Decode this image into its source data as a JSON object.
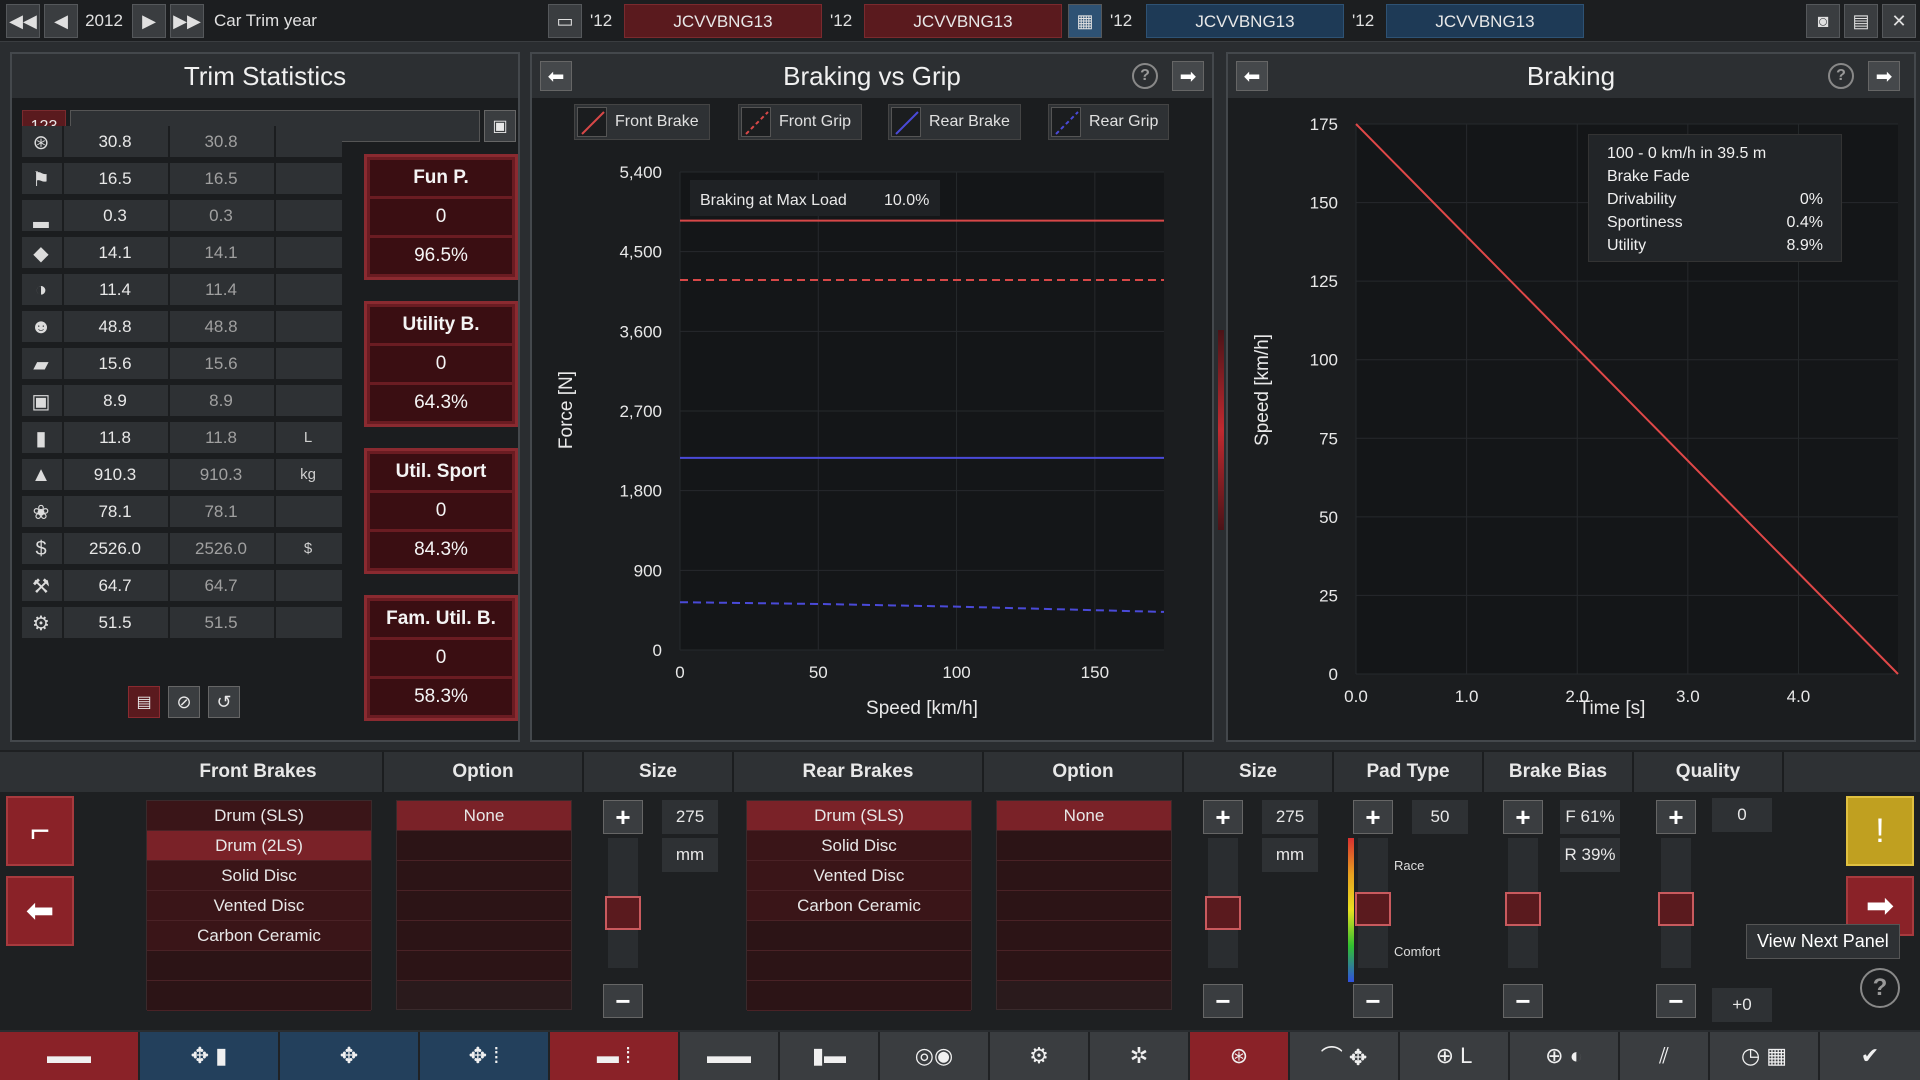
{
  "topbar": {
    "year": "2012",
    "trim_label": "Car Trim year",
    "slots": [
      {
        "year": "'12",
        "name": "JCVVBNG13"
      },
      {
        "year": "'12",
        "name": "JCVVBNG13"
      },
      {
        "year": "'12",
        "name": "JCVVBNG13"
      },
      {
        "year": "'12",
        "name": "JCVVBNG13"
      }
    ]
  },
  "trim": {
    "title": "Trim Statistics",
    "search_label": "123",
    "rows": [
      {
        "icon": "steering-wheel-icon",
        "v1": "30.8",
        "v2": "30.8",
        "unit": ""
      },
      {
        "icon": "race-flag-icon",
        "v1": "16.5",
        "v2": "16.5",
        "unit": ""
      },
      {
        "icon": "seat-icon",
        "v1": "0.3",
        "v2": "0.3",
        "unit": ""
      },
      {
        "icon": "diamond-icon",
        "v1": "14.1",
        "v2": "14.1",
        "unit": ""
      },
      {
        "icon": "safety-icon",
        "v1": "11.4",
        "v2": "11.4",
        "unit": ""
      },
      {
        "icon": "passengers-icon",
        "v1": "48.8",
        "v2": "48.8",
        "unit": ""
      },
      {
        "icon": "cargo-car-icon",
        "v1": "15.6",
        "v2": "15.6",
        "unit": ""
      },
      {
        "icon": "offroad-car-icon",
        "v1": "8.9",
        "v2": "8.9",
        "unit": ""
      },
      {
        "icon": "fuel-can-icon",
        "v1": "11.8",
        "v2": "11.8",
        "unit": "L"
      },
      {
        "icon": "weight-icon",
        "v1": "910.3",
        "v2": "910.3",
        "unit": "kg"
      },
      {
        "icon": "environment-icon",
        "v1": "78.1",
        "v2": "78.1",
        "unit": ""
      },
      {
        "icon": "money-bag-icon",
        "v1": "2526.0",
        "v2": "2526.0",
        "unit": "$"
      },
      {
        "icon": "service-icon",
        "v1": "64.7",
        "v2": "64.7",
        "unit": ""
      },
      {
        "icon": "gear-wrench-icon",
        "v1": "51.5",
        "v2": "51.5",
        "unit": ""
      }
    ],
    "scores": [
      {
        "title": "Fun P.",
        "num": "0",
        "pct": "96.5%"
      },
      {
        "title": "Utility B.",
        "num": "0",
        "pct": "64.3%"
      },
      {
        "title": "Util. Sport",
        "num": "0",
        "pct": "84.3%"
      },
      {
        "title": "Fam. Util. B.",
        "num": "0",
        "pct": "58.3%"
      }
    ]
  },
  "grip": {
    "title": "Braking vs Grip",
    "legend": [
      "Front Brake",
      "Front Grip",
      "Rear Brake",
      "Rear Grip"
    ],
    "annotation_label": "Braking at Max Load",
    "annotation_value": "10.0%"
  },
  "braking": {
    "title": "Braking",
    "info": {
      "line1": "100 - 0 km/h in 39.5 m",
      "line2": "Brake Fade",
      "rows": [
        {
          "k": "Drivability",
          "v": "0%"
        },
        {
          "k": "Sportiness",
          "v": "0.4%"
        },
        {
          "k": "Utility",
          "v": "8.9%"
        }
      ]
    }
  },
  "chart_data": [
    {
      "type": "line",
      "title": "Braking vs Grip",
      "xlabel": "Speed [km/h]",
      "ylabel": "Force [N]",
      "xlim": [
        0,
        175
      ],
      "ylim": [
        0,
        5400
      ],
      "xticks": [
        "0",
        "50",
        "100",
        "150"
      ],
      "yticks": [
        "0",
        "900",
        "1,800",
        "2,700",
        "3,600",
        "4,500",
        "5,400"
      ],
      "series": [
        {
          "name": "Front Brake",
          "color": "#d84848",
          "dash": false,
          "x": [
            0,
            175
          ],
          "y": [
            4850,
            4850
          ]
        },
        {
          "name": "Front Grip",
          "color": "#d84848",
          "dash": true,
          "x": [
            0,
            175
          ],
          "y": [
            4180,
            4180
          ]
        },
        {
          "name": "Rear Brake",
          "color": "#4a4ad8",
          "dash": false,
          "x": [
            0,
            175
          ],
          "y": [
            2170,
            2170
          ]
        },
        {
          "name": "Rear Grip",
          "color": "#4a4ad8",
          "dash": true,
          "x": [
            0,
            50,
            100,
            150,
            175
          ],
          "y": [
            540,
            520,
            490,
            450,
            430
          ]
        }
      ]
    },
    {
      "type": "line",
      "title": "Braking",
      "xlabel": "Time [s]",
      "ylabel": "Speed [km/h]",
      "xlim": [
        0,
        4.9
      ],
      "ylim": [
        0,
        175
      ],
      "xticks": [
        "0.0",
        "1.0",
        "2.0",
        "3.0",
        "4.0"
      ],
      "yticks": [
        "0",
        "25",
        "50",
        "75",
        "100",
        "125",
        "150",
        "175"
      ],
      "series": [
        {
          "color": "#e04848",
          "x": [
            0,
            4.9
          ],
          "y": [
            175,
            0
          ]
        }
      ]
    }
  ],
  "bottom": {
    "heads": {
      "front_brakes": "Front Brakes",
      "option1": "Option",
      "size1": "Size",
      "rear_brakes": "Rear Brakes",
      "option2": "Option",
      "size2": "Size",
      "pad": "Pad Type",
      "bias": "Brake Bias",
      "quality": "Quality"
    },
    "front_list": [
      "Drum (SLS)",
      "Drum (2LS)",
      "Solid Disc",
      "Vented Disc",
      "Carbon Ceramic"
    ],
    "front_selected": 1,
    "option1": "None",
    "size1": "275",
    "size1_unit": "mm",
    "rear_list": [
      "Drum (SLS)",
      "Solid Disc",
      "Vented Disc",
      "Carbon Ceramic"
    ],
    "rear_selected": 0,
    "option2": "None",
    "size2": "275",
    "size2_unit": "mm",
    "pad_value": "50",
    "pad_top": "Race",
    "pad_bottom": "Comfort",
    "bias_front": "F 61%",
    "bias_rear": "R 39%",
    "quality_value": "0",
    "quality_delta": "+0",
    "tooltip": "View Next Panel"
  },
  "colors": {
    "accent": "#8a2228",
    "brand_blue": "#23405c"
  }
}
